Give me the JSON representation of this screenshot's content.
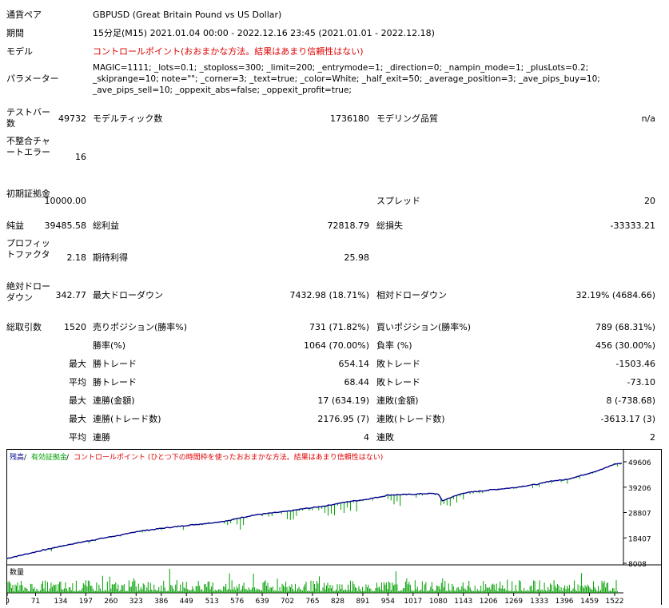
{
  "report": {
    "symbol_label": "通貨ペア",
    "symbol_value": "GBPUSD (Great Britain Pound vs US Dollar)",
    "period_label": "期間",
    "period_value": "15分足(M15) 2021.01.04 00:00 - 2022.12.16 23:45 (2021.01.01 - 2022.12.18)",
    "model_label": "モデル",
    "model_value": "コントロールポイント(おおまかな方法。結果はあまり信頼性はない)",
    "params_label": "パラメーター",
    "params_value": "MAGIC=1111; _lots=0.1; _stoploss=300; _limit=200; _entrymode=1; _direction=0; _nampin_mode=1; _plusLots=0.2; _skiprange=10; note=\"\"; _corner=3; _text=true; _color=White; _half_exit=50; _average_position=3; _ave_pips_buy=10; _ave_pips_sell=10; _oppexit_abs=false; _oppexit_profit=true;",
    "bars_label": "テストバー数",
    "bars_value": "49732",
    "ticks_label": "モデルティック数",
    "ticks_value": "1736180",
    "quality_label": "モデリング品質",
    "quality_value": "n/a",
    "mismatch_label": "不整合チャートエラー",
    "mismatch_value": "16",
    "deposit_label": "初期証拠金",
    "deposit_value": "10000.00",
    "spread_label": "スプレッド",
    "spread_value": "20",
    "net_label": "純益",
    "net_value": "39485.58",
    "gross_profit_label": "総利益",
    "gross_profit_value": "72818.79",
    "gross_loss_label": "総損失",
    "gross_loss_value": "-33333.21",
    "pf_label": "プロフィットファクタ",
    "pf_value": "2.18",
    "expected_label": "期待利得",
    "expected_value": "25.98",
    "abs_dd_label": "絶対ドローダウン",
    "abs_dd_value": "342.77",
    "max_dd_label": "最大ドローダウン",
    "max_dd_value": "7432.98 (18.71%)",
    "rel_dd_label": "相対ドローダウン",
    "rel_dd_value": "32.19% (4684.66)",
    "total_trades_label": "総取引数",
    "total_trades_value": "1520",
    "short_label": "売りポジション(勝率%)",
    "short_value": "731 (71.82%)",
    "long_label": "買いポジション(勝率%)",
    "long_value": "789 (68.31%)",
    "win_rate_label": "勝率(%)",
    "win_rate_value": "1064 (70.00%)",
    "loss_rate_label": "負率 (%)",
    "loss_rate_value": "456 (30.00%)",
    "max_label": "最大",
    "avg_label": "平均",
    "largest_win_label": "勝トレード",
    "largest_win_value": "654.14",
    "largest_loss_label": "敗トレード",
    "largest_loss_value": "-1503.46",
    "avg_win_label": "勝トレード",
    "avg_win_value": "68.44",
    "avg_loss_label": "敗トレード",
    "avg_loss_value": "-73.10",
    "max_cons_wins_label": "連勝(金額)",
    "max_cons_wins_value": "17 (634.19)",
    "max_cons_losses_label": "連敗(金額)",
    "max_cons_losses_value": "8 (-738.68)",
    "max_cons_profit_label": "連勝(トレード数)",
    "max_cons_profit_value": "2176.95 (7)",
    "max_cons_loss_label": "連敗(トレード数)",
    "max_cons_loss_value": "-3613.17 (3)",
    "avg_cons_wins_label": "連勝",
    "avg_cons_wins_value": "4",
    "avg_cons_losses_label": "連敗",
    "avg_cons_losses_value": "2"
  },
  "chart_data": {
    "type": "line",
    "legend": {
      "balance": "残高",
      "sep1": " / ",
      "equity": "有効証拠金",
      "sep2": " / ",
      "model_note": "コントロールポイント (ひとつ下の時間枠を使ったおおまかな方法。結果はあまり信頼性はない)"
    },
    "volume_label": "数量",
    "y_ticks": [
      49606,
      39206,
      28807,
      18407,
      8008
    ],
    "ylim": [
      8008,
      49606
    ],
    "x_ticks": [
      0,
      71,
      134,
      197,
      260,
      323,
      386,
      449,
      513,
      576,
      639,
      702,
      765,
      828,
      891,
      954,
      1017,
      1080,
      1143,
      1206,
      1269,
      1333,
      1396,
      1459,
      1522
    ],
    "xlim": [
      0,
      1540
    ],
    "series": [
      {
        "x": [
          0,
          40,
          80,
          134,
          197,
          260,
          300,
          323,
          386,
          449,
          513,
          560,
          576,
          620,
          639,
          680,
          702,
          740,
          765,
          800,
          828,
          860,
          891,
          940,
          954,
          1000,
          1017,
          1040,
          1060,
          1080,
          1090,
          1110,
          1143,
          1180,
          1206,
          1269,
          1300,
          1333,
          1360,
          1396,
          1430,
          1459,
          1490,
          1522,
          1540
        ],
        "y": [
          10000,
          11500,
          13000,
          15000,
          17000,
          18900,
          20000,
          21000,
          22300,
          23500,
          24600,
          25600,
          26400,
          27800,
          28200,
          28900,
          29300,
          30300,
          30800,
          31600,
          32500,
          33400,
          34000,
          35400,
          36000,
          36200,
          36300,
          36500,
          36600,
          36400,
          33600,
          34900,
          36800,
          37500,
          38000,
          39000,
          39800,
          40500,
          41700,
          42200,
          43600,
          45000,
          46500,
          48700,
          49000
        ]
      }
    ],
    "colors": {
      "balance": "#00008b",
      "equity": "#00a000",
      "volume": "#00a000",
      "note": "#e00000"
    }
  }
}
